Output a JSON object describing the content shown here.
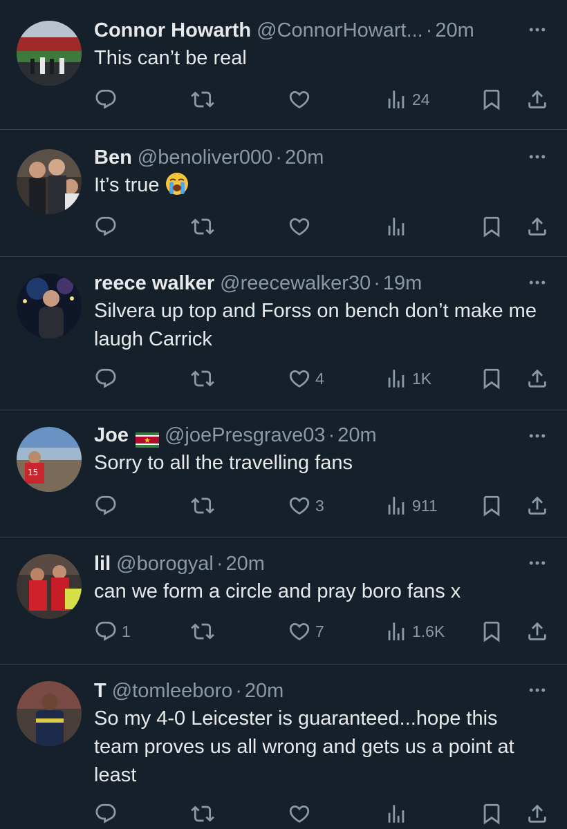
{
  "colors": {
    "background": "#15202b",
    "divider": "#38444d",
    "primary_text": "#e7e9ea",
    "secondary_text": "#8b98a5"
  },
  "icons": {
    "reply": "reply-icon",
    "retweet": "retweet-icon",
    "like": "heart-icon",
    "views": "views-icon",
    "bookmark": "bookmark-icon",
    "share": "share-icon",
    "more": "more-icon"
  },
  "tweets": [
    {
      "name": "Connor Howarth",
      "handle": "@ConnorHowart...",
      "separator": "·",
      "time": "20m",
      "text": "This can’t be real",
      "replies": "",
      "retweets": "",
      "likes": "",
      "views": "24"
    },
    {
      "name": "Ben",
      "handle": "@benoliver000",
      "separator": "·",
      "time": "20m",
      "text": "It’s true",
      "emoji": "loudly-crying-face-emoji",
      "replies": "",
      "retweets": "",
      "likes": "",
      "views": ""
    },
    {
      "name": "reece walker",
      "handle": "@reecewalker30",
      "separator": "·",
      "time": "19m",
      "text": "Silvera up top and Forss on bench don’t make me laugh Carrick",
      "replies": "",
      "retweets": "",
      "likes": "4",
      "views": "1K"
    },
    {
      "name": "Joe",
      "flag": "suriname-flag",
      "handle": "@joePresgrave03",
      "separator": "·",
      "time": "20m",
      "text": "Sorry to all the travelling fans",
      "replies": "",
      "retweets": "",
      "likes": "3",
      "views": "911"
    },
    {
      "name": "lil",
      "handle": "@borogyal",
      "separator": "·",
      "time": "20m",
      "text": "can we form a circle and pray boro fans x",
      "replies": "1",
      "retweets": "",
      "likes": "7",
      "views": "1.6K"
    },
    {
      "name": "T",
      "handle": "@tomleeboro",
      "separator": "·",
      "time": "20m",
      "text": "So my 4-0 Leicester is guaranteed...hope this team proves us all wrong and gets us a point at least",
      "replies": "",
      "retweets": "",
      "likes": "",
      "views": ""
    }
  ]
}
